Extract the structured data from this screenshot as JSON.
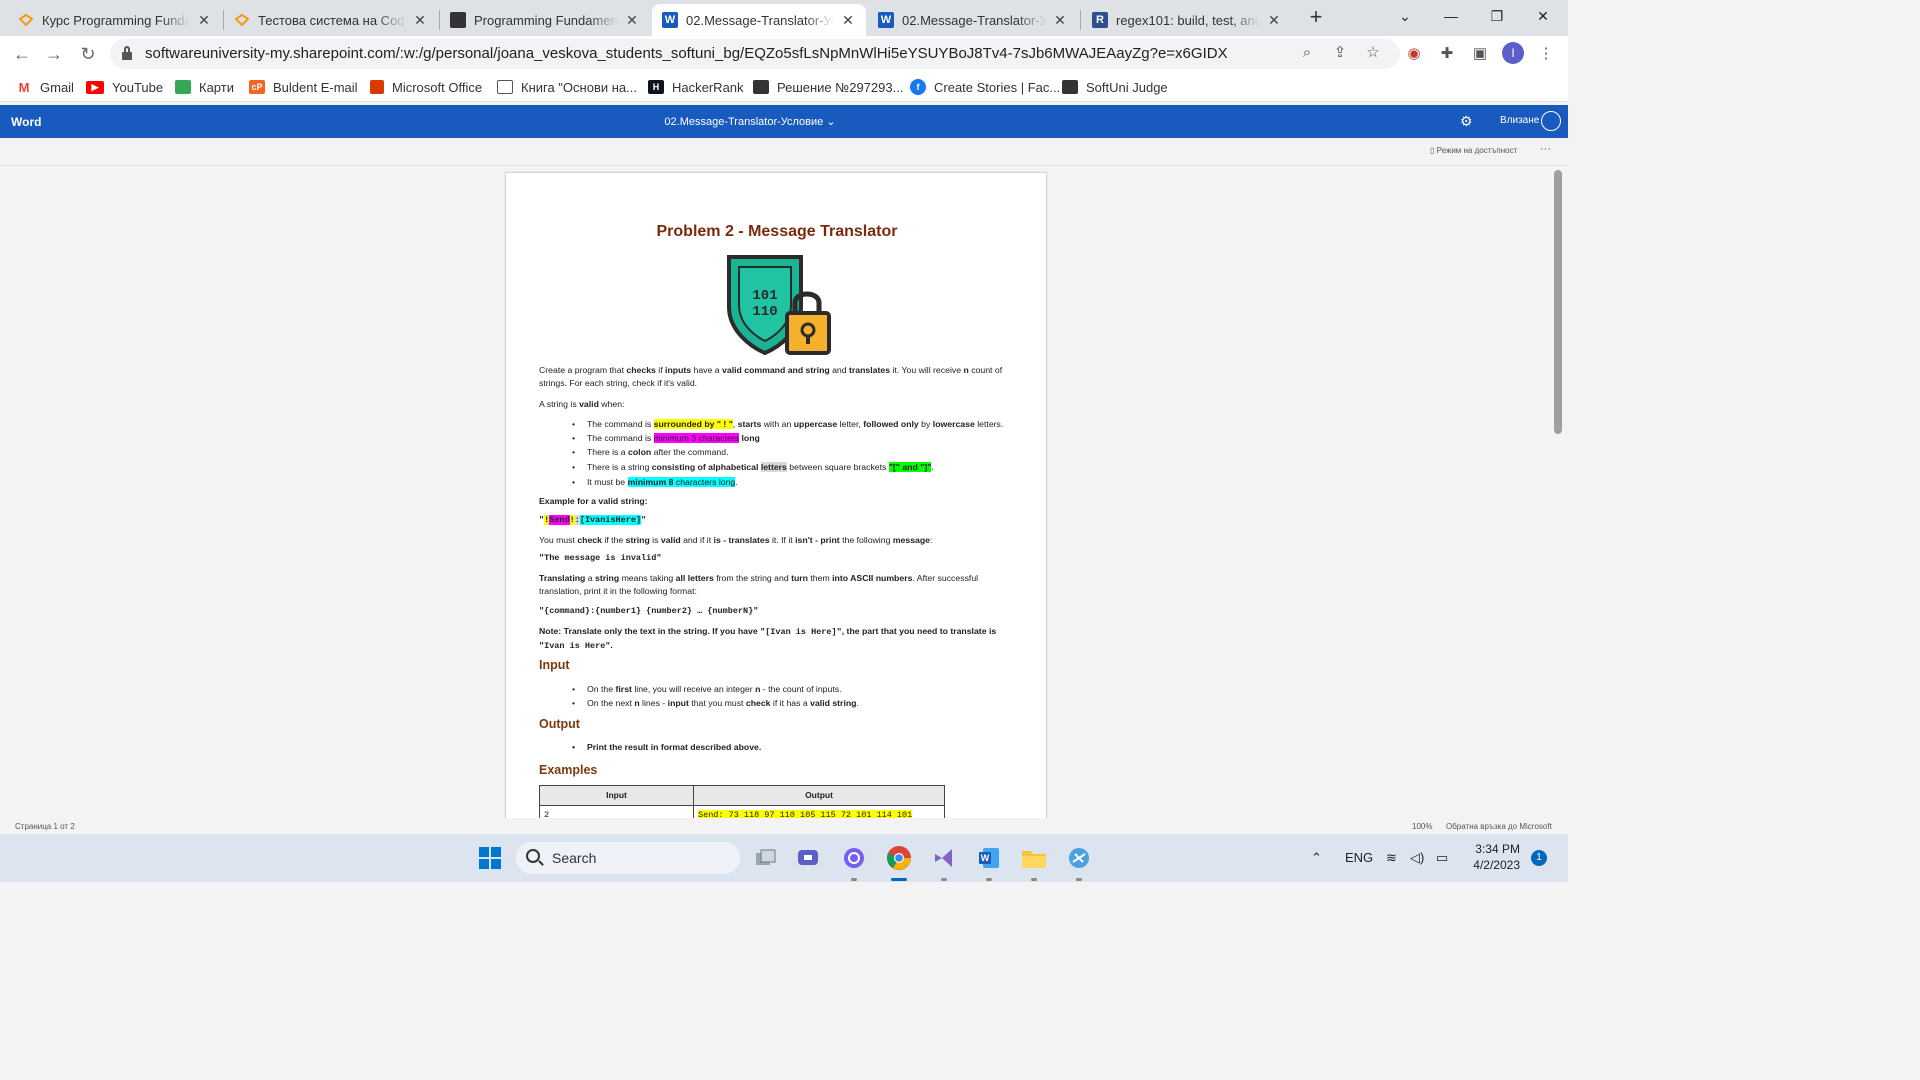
{
  "browser": {
    "tabs": [
      {
        "title": "Курс Programming Fundam",
        "icon": "softuni-icon"
      },
      {
        "title": "Тестова система на СофтУ",
        "icon": "softuni-icon"
      },
      {
        "title": "Programming Fundamental",
        "icon": "terminal-icon"
      },
      {
        "title": "02.Message-Translator-Усл",
        "icon": "word-icon"
      },
      {
        "title": "02.Message-Translator-Усл",
        "icon": "word-icon"
      },
      {
        "title": "regex101: build, test, and d",
        "icon": "regex101-icon"
      }
    ],
    "active_tab": 3,
    "url": "softwareuniversity-my.sharepoint.com/:w:/g/personal/joana_veskova_students_softuni_bg/EQZo5sfLsNpMnWlHi5eYSUYBoJ8Tv4-7sJb6MWAJEAayZg?e=x6GIDX",
    "profile_letter": "I",
    "bookmarks": [
      {
        "label": "Gmail",
        "icon": "gmail-icon"
      },
      {
        "label": "YouTube",
        "icon": "youtube-icon"
      },
      {
        "label": "Карти",
        "icon": "maps-icon"
      },
      {
        "label": "Buldent E-mail",
        "icon": "mail-icon"
      },
      {
        "label": "Microsoft Office",
        "icon": "office-icon"
      },
      {
        "label": "Книга \"Основи на...",
        "icon": "book-icon"
      },
      {
        "label": "HackerRank",
        "icon": "hackerrank-icon"
      },
      {
        "label": "Решение №297293...",
        "icon": "folder-icon"
      },
      {
        "label": "Create Stories | Fac...",
        "icon": "facebook-icon"
      },
      {
        "label": "SoftUni Judge",
        "icon": "folder-icon"
      }
    ]
  },
  "word": {
    "app_name": "Word",
    "doc_title": "02.Message-Translator-Условие",
    "sign_in": "Влизане",
    "accessibility": "Режим на достъпност",
    "status_page": "Страница 1 от 2",
    "zoom": "100%",
    "feedback": "Обратна връзка до Microsoft"
  },
  "doc": {
    "title": "Problem 2 - Message Translator",
    "intro": {
      "p1": "Create a program that ",
      "p2": "checks",
      "p3": " if ",
      "p4": "inputs",
      "p5": " have a ",
      "p6": "valid command and string",
      "p7": " and ",
      "p8": "translates",
      "p9": " it. You will receive ",
      "p10": "n",
      "p11": " count of strings. For each string, check if it's valid."
    },
    "valid_when": {
      "a": "A string is ",
      "b": "valid",
      "c": " when:"
    },
    "bullets": {
      "b1": {
        "a": "The command is ",
        "b": "surrounded by \" ! \"",
        "c": ", ",
        "d": "starts",
        "e": " with an ",
        "f": "uppercase",
        "g": " letter, ",
        "h": "followed only",
        "i": " by ",
        "j": "lowercase",
        "k": " letters."
      },
      "b2": {
        "a": "The command is ",
        "b": "minimum 3 characters",
        "c": " long"
      },
      "b3": {
        "a": "There is a ",
        "b": "colon",
        "c": " after the command."
      },
      "b4": {
        "a": "There is a string ",
        "b": "consisting of alphabetical ",
        "c": "letters",
        "d": " between square brackets ",
        "e": "\"[\" and \"]\"",
        "f": "."
      },
      "b5": {
        "a": "It must be ",
        "b": "minimum 8",
        "c": " characters long",
        "d": "."
      }
    },
    "example_label": "Example for a valid string:",
    "example": {
      "q1": "\"",
      "ex1": "!",
      "cmd": "Send",
      "ex2": "!",
      "colon": ":",
      "str": "[IvanisHere]",
      "q2": "\""
    },
    "must_check": {
      "a": "You must ",
      "b": "check",
      "c": " if the ",
      "d": "string",
      "e": " is ",
      "f": "valid",
      "g": " and if it ",
      "h": "is - translates",
      "i": " it. If it ",
      "j": "isn't - print",
      "k": " the following ",
      "l": "message",
      "m": ":"
    },
    "invalid_msg": "\"The message is invalid\"",
    "translating": {
      "a": "Translating",
      "b": " a ",
      "c": "string",
      "d": " means taking ",
      "e": "all letters",
      "f": " from the string and ",
      "g": "turn",
      "h": " them ",
      "i": "into ASCII numbers",
      "j": ". After successful translation, print it in the following format:"
    },
    "format": "\"{command}:{number1} {number2} … {numberN}\"",
    "note": {
      "a": "Note: Translate only the text in the string. If you have ",
      "b": "\"[Ivan is Here]\"",
      "c": ", the part that you need to translate is ",
      "d": "\"Ivan is Here\"",
      "e": "."
    },
    "input_heading": "Input",
    "input_b1": {
      "a": "On the ",
      "b": "first",
      "c": " line, you will receive an integer ",
      "d": "n",
      "e": " - the count of inputs."
    },
    "input_b2": {
      "a": "On the next ",
      "b": "n",
      "c": " lines - ",
      "d": "input",
      "e": " that you must ",
      "f": "check",
      "g": " if it has a ",
      "h": "valid string",
      "i": "."
    },
    "output_heading": "Output",
    "output_b1": "Print the result in format described above.",
    "examples_heading": "Examples",
    "table": {
      "col_input": "Input",
      "col_output": "Output",
      "row1_input": "2",
      "row1_output": "Send: 73 118 97 110 105 115 72 101 114 101"
    }
  },
  "taskbar": {
    "search": "Search",
    "lang": "ENG",
    "time": "3:34 PM",
    "date": "4/2/2023",
    "notifications": "1"
  }
}
